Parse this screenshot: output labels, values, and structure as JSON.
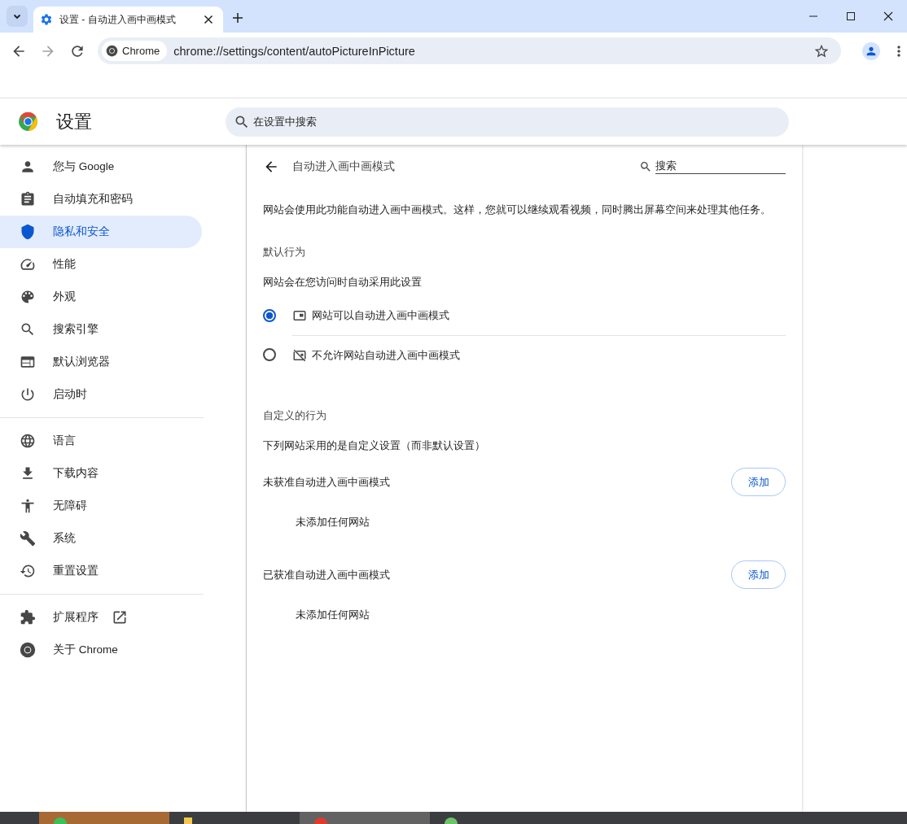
{
  "browser": {
    "tabs": [
      {
        "title": "设置 - 自动进入画中画模式",
        "selected": true
      }
    ],
    "address_bar": {
      "chip": "Chrome",
      "url": "chrome://settings/content/autoPictureInPicture"
    }
  },
  "settings_header": {
    "title": "设置",
    "search_placeholder": "在设置中搜索"
  },
  "sidebar": {
    "groups": [
      [
        {
          "label": "您与 Google",
          "selected": false,
          "external_link": false
        },
        {
          "label": "自动填充和密码",
          "selected": false,
          "external_link": false
        },
        {
          "label": "隐私和安全",
          "selected": true,
          "external_link": false
        },
        {
          "label": "性能",
          "selected": false,
          "external_link": false
        },
        {
          "label": "外观",
          "selected": false,
          "external_link": false
        },
        {
          "label": "搜索引擎",
          "selected": false,
          "external_link": false
        },
        {
          "label": "默认浏览器",
          "selected": false,
          "external_link": false
        },
        {
          "label": "启动时",
          "selected": false,
          "external_link": false
        }
      ],
      [
        {
          "label": "语言",
          "selected": false,
          "external_link": false
        },
        {
          "label": "下载内容",
          "selected": false,
          "external_link": false
        },
        {
          "label": "无障碍",
          "selected": false,
          "external_link": false
        },
        {
          "label": "系统",
          "selected": false,
          "external_link": false
        },
        {
          "label": "重置设置",
          "selected": false,
          "external_link": false
        }
      ],
      [
        {
          "label": "扩展程序",
          "selected": false,
          "external_link": true
        },
        {
          "label": "关于 Chrome",
          "selected": false,
          "external_link": false
        }
      ]
    ]
  },
  "page": {
    "title": "自动进入画中画模式",
    "search_placeholder": "搜索",
    "description": "网站会使用此功能自动进入画中画模式。这样，您就可以继续观看视频，同时腾出屏幕空间来处理其他任务。",
    "default_behavior": {
      "heading": "默认行为",
      "subheading": "网站会在您访问时自动采用此设置",
      "options": [
        {
          "label": "网站可以自动进入画中画模式",
          "selected": true,
          "kind": "allow"
        },
        {
          "label": "不允许网站自动进入画中画模式",
          "selected": false,
          "kind": "block"
        }
      ]
    },
    "custom_behavior": {
      "heading": "自定义的行为",
      "subheading": "下列网站采用的是自定义设置（而非默认设置）",
      "lists": [
        {
          "title": "未获准自动进入画中画模式",
          "button": "添加",
          "empty": "未添加任何网站"
        },
        {
          "title": "已获准自动进入画中画模式",
          "button": "添加",
          "empty": "未添加任何网站"
        }
      ]
    }
  }
}
